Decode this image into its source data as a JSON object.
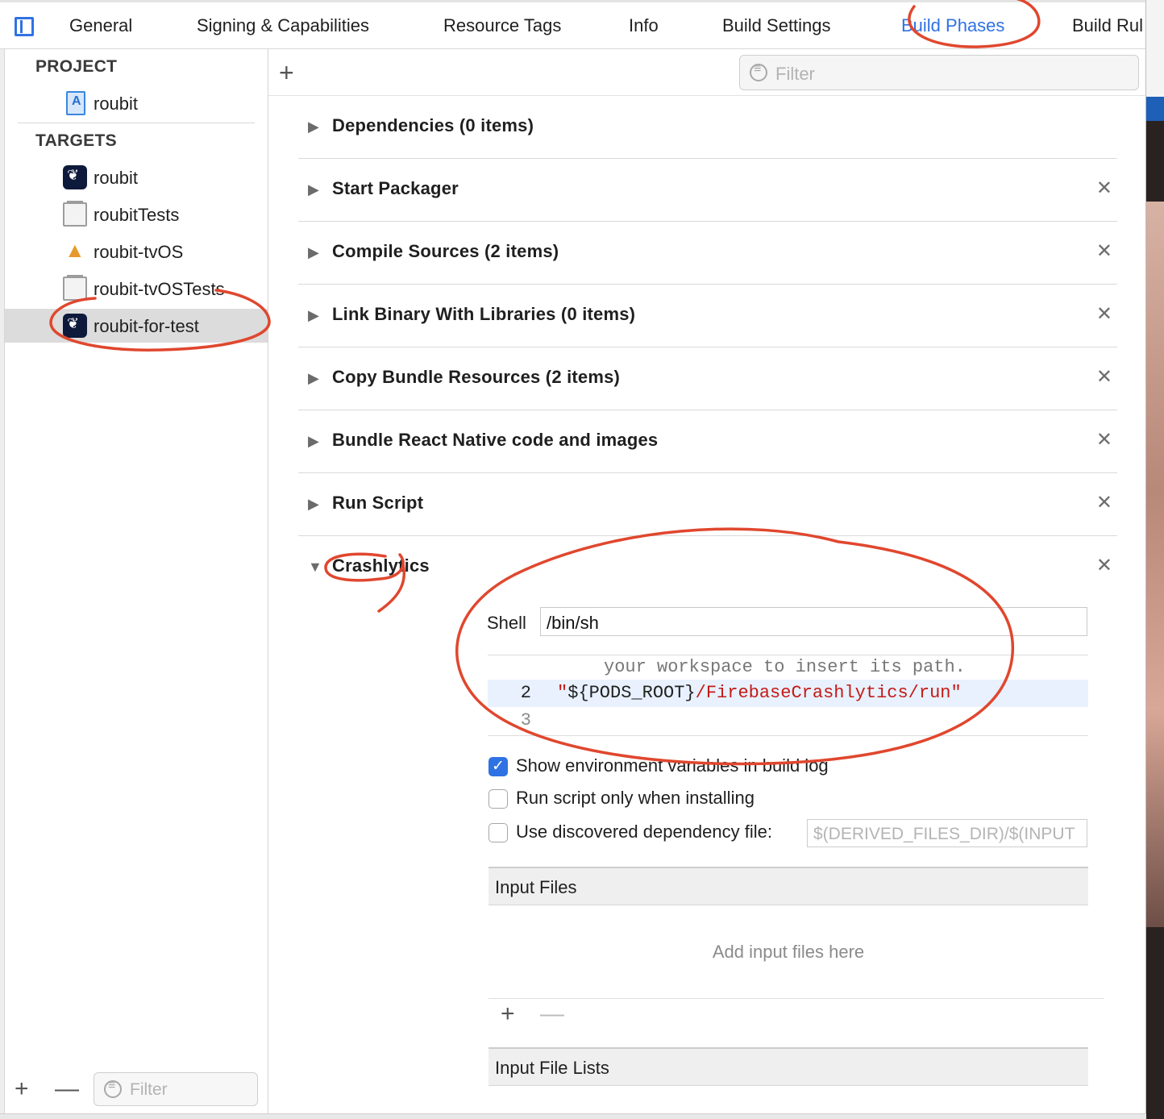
{
  "tabs": [
    {
      "label": "General",
      "active": false
    },
    {
      "label": "Signing & Capabilities",
      "active": false
    },
    {
      "label": "Resource Tags",
      "active": false
    },
    {
      "label": "Info",
      "active": false
    },
    {
      "label": "Build Settings",
      "active": false
    },
    {
      "label": "Build Phases",
      "active": true
    },
    {
      "label": "Build Rul",
      "active": false
    }
  ],
  "sidebar": {
    "project_header": "PROJECT",
    "project_item": "roubit",
    "targets_header": "TARGETS",
    "targets": [
      {
        "label": "roubit",
        "icon": "app-icon"
      },
      {
        "label": "roubitTests",
        "icon": "bundle-icon"
      },
      {
        "label": "roubit-tvOS",
        "icon": "tvos-app-icon"
      },
      {
        "label": "roubit-tvOSTests",
        "icon": "bundle-icon"
      },
      {
        "label": "roubit-for-test",
        "icon": "app-icon",
        "selected": true
      }
    ],
    "filter_placeholder": "Filter"
  },
  "main": {
    "filter_placeholder": "Filter",
    "phases": [
      {
        "title": "Dependencies (0 items)",
        "removable": false
      },
      {
        "title": "Start Packager",
        "removable": true
      },
      {
        "title": "Compile Sources (2 items)",
        "removable": true
      },
      {
        "title": "Link Binary With Libraries (0 items)",
        "removable": true
      },
      {
        "title": "Copy Bundle Resources (2 items)",
        "removable": true
      },
      {
        "title": "Bundle React Native code and images",
        "removable": true
      },
      {
        "title": "Run Script",
        "removable": true
      },
      {
        "title": "Crashlytics",
        "removable": true,
        "expanded": true
      }
    ],
    "close_glyph": "✕",
    "crashlytics": {
      "shell_label": "Shell",
      "shell_value": "/bin/sh",
      "code": {
        "comment_line": "your workspace to insert its path.",
        "line2_number": "2",
        "line2_quote_open": "\"",
        "line2_var": "${PODS_ROOT}",
        "line2_path": "/FirebaseCrashlytics/run",
        "line2_quote_close": "\"",
        "line3_number": "3"
      },
      "options": [
        {
          "label": "Show environment variables in build log",
          "checked": true
        },
        {
          "label": "Run script only when installing",
          "checked": false
        },
        {
          "label": "Use discovered dependency file:",
          "checked": false
        }
      ],
      "depfile_placeholder": "$(DERIVED_FILES_DIR)/$(INPUT",
      "input_files_header": "Input Files",
      "input_files_placeholder": "Add input files here",
      "input_file_lists_header": "Input File Lists"
    }
  },
  "colors": {
    "accent": "#2f72e4",
    "annotation": "#e0472e",
    "string": "#c41a16"
  }
}
